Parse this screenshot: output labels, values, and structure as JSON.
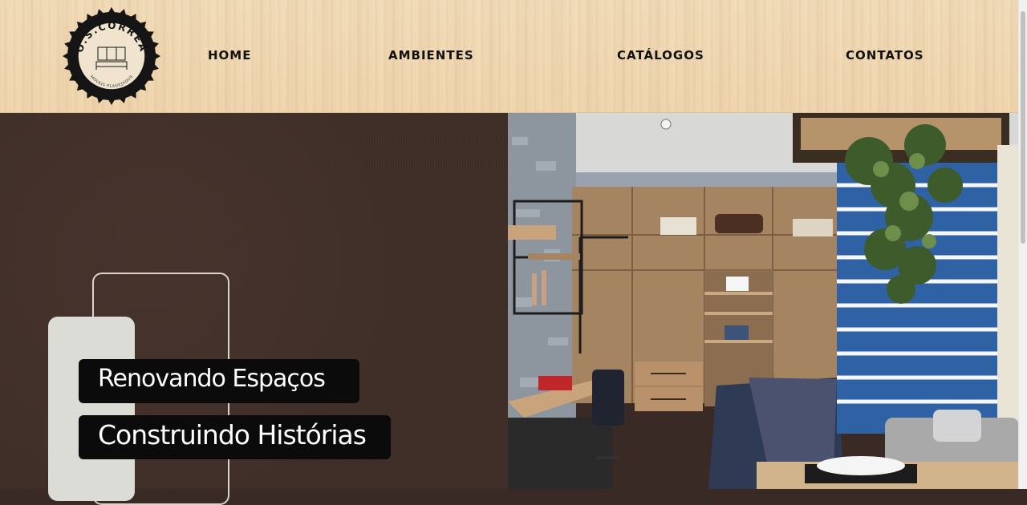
{
  "brand": {
    "logo_top_text": "O.S.CORREA",
    "logo_bottom_text": "MÓVEIS PLANEJADOS"
  },
  "nav": {
    "items": [
      {
        "label": "HOME"
      },
      {
        "label": "AMBIENTES"
      },
      {
        "label": "CATÁLOGOS"
      },
      {
        "label": "CONTATOS"
      }
    ]
  },
  "hero": {
    "line1": "Renovando Espaços",
    "line2": "Construindo Histórias",
    "image_icon": "room-photo"
  },
  "colors": {
    "header_bg": "#f2dab4",
    "hero_bg": "#3f2d27",
    "tag_bg": "#0b0b0b",
    "nav_text": "#111111"
  }
}
